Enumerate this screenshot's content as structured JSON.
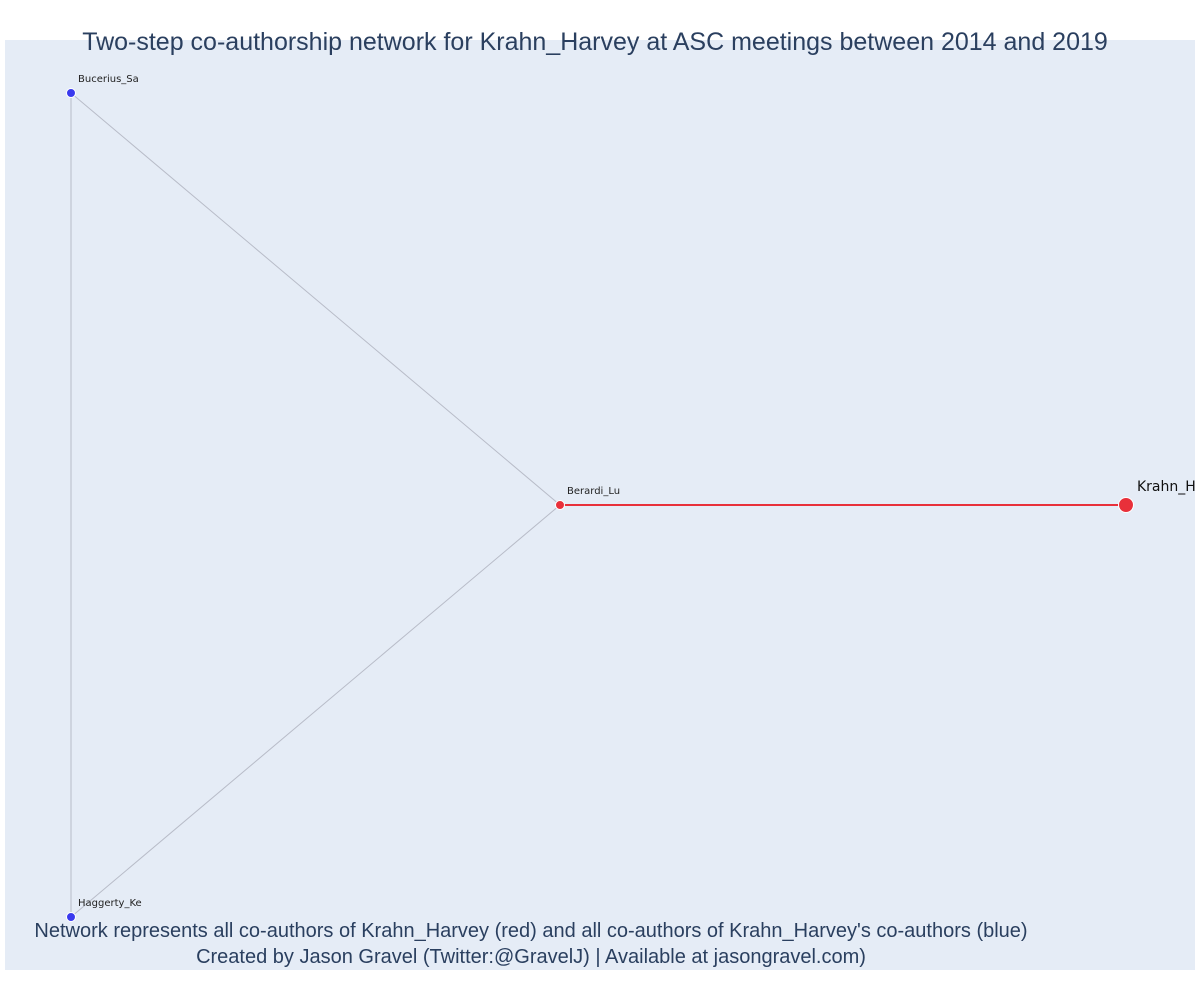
{
  "title": "Two-step co-authorship network for Krahn_Harvey at ASC meetings between 2014 and 2019",
  "footer": {
    "line1": "Network represents all co-authors of Krahn_Harvey (red) and all co-authors of Krahn_Harvey's co-authors (blue)",
    "line2": "Created by Jason Gravel (Twitter:@GravelJ) | Available at jasongravel.com)"
  },
  "colors": {
    "plot_background": "#e5ecf6",
    "first_step": "#e8303a",
    "second_step": "#3a3aee",
    "edge": "#b8bcc8",
    "text": "#2a3f5f"
  },
  "network": {
    "nodes": [
      {
        "id": "Bucerius_Sa",
        "label": "Bucerius_Sa",
        "group": "second-step"
      },
      {
        "id": "Berardi_Lu",
        "label": "Berardi_Lu",
        "group": "first-step"
      },
      {
        "id": "Krahn_H",
        "label": "Krahn_H",
        "group": "focal"
      },
      {
        "id": "Haggerty_Ke",
        "label": "Haggerty_Ke",
        "group": "second-step"
      }
    ],
    "edges": [
      {
        "source": "Bucerius_Sa",
        "target": "Berardi_Lu",
        "type": "second-step"
      },
      {
        "source": "Haggerty_Ke",
        "target": "Berardi_Lu",
        "type": "second-step"
      },
      {
        "source": "Bucerius_Sa",
        "target": "Haggerty_Ke",
        "type": "second-step"
      },
      {
        "source": "Berardi_Lu",
        "target": "Krahn_H",
        "type": "first-step"
      }
    ]
  }
}
